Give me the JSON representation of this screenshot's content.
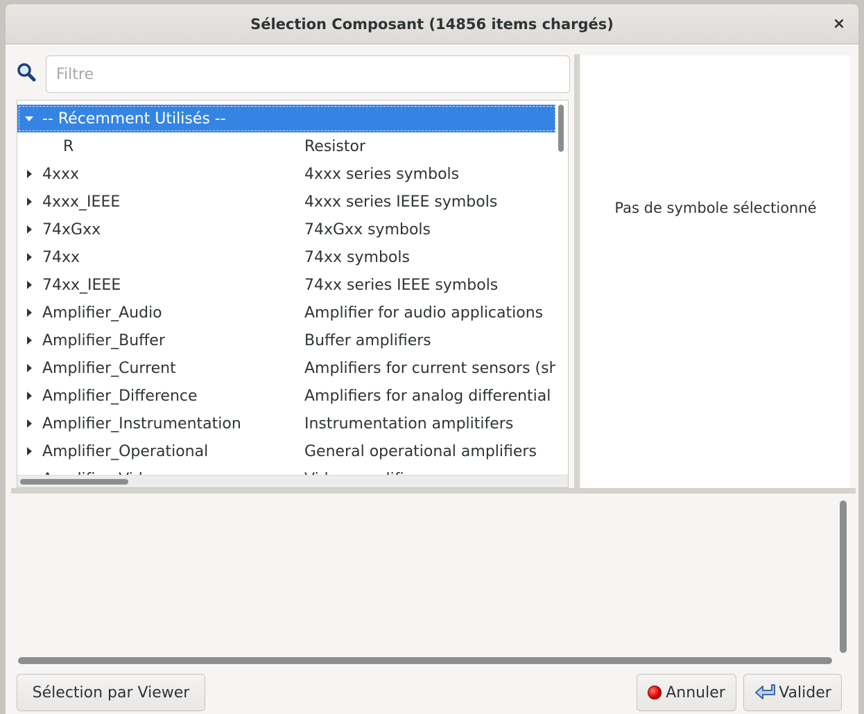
{
  "window": {
    "title": "Sélection Composant (14856 items chargés)",
    "close_label": "×"
  },
  "filter": {
    "placeholder": "Filtre",
    "value": ""
  },
  "tree": {
    "rows": [
      {
        "name": "-- Récemment Utilisés --",
        "desc": "",
        "state": "expanded",
        "selected": true,
        "child": false
      },
      {
        "name": "R",
        "desc": "Resistor",
        "state": "leaf",
        "selected": false,
        "child": true
      },
      {
        "name": "4xxx",
        "desc": "4xxx series symbols",
        "state": "collapsed",
        "selected": false,
        "child": false
      },
      {
        "name": "4xxx_IEEE",
        "desc": "4xxx series IEEE symbols",
        "state": "collapsed",
        "selected": false,
        "child": false
      },
      {
        "name": "74xGxx",
        "desc": "74xGxx symbols",
        "state": "collapsed",
        "selected": false,
        "child": false
      },
      {
        "name": "74xx",
        "desc": "74xx symbols",
        "state": "collapsed",
        "selected": false,
        "child": false
      },
      {
        "name": "74xx_IEEE",
        "desc": "74xx series IEEE symbols",
        "state": "collapsed",
        "selected": false,
        "child": false
      },
      {
        "name": "Amplifier_Audio",
        "desc": "Amplifier for audio applications",
        "state": "collapsed",
        "selected": false,
        "child": false
      },
      {
        "name": "Amplifier_Buffer",
        "desc": "Buffer amplifiers",
        "state": "collapsed",
        "selected": false,
        "child": false
      },
      {
        "name": "Amplifier_Current",
        "desc": "Amplifiers for current sensors (shu",
        "state": "collapsed",
        "selected": false,
        "child": false
      },
      {
        "name": "Amplifier_Difference",
        "desc": "Amplifiers for analog differential s",
        "state": "collapsed",
        "selected": false,
        "child": false
      },
      {
        "name": "Amplifier_Instrumentation",
        "desc": "Instrumentation amplitifers",
        "state": "collapsed",
        "selected": false,
        "child": false
      },
      {
        "name": "Amplifier_Operational",
        "desc": "General operational amplifiers",
        "state": "collapsed",
        "selected": false,
        "child": false
      },
      {
        "name": "Amplifier_Video",
        "desc": "Video amplifiers",
        "state": "collapsed",
        "selected": false,
        "child": false
      }
    ]
  },
  "preview": {
    "empty_text": "Pas de symbole sélectionné"
  },
  "buttons": {
    "viewer": "Sélection par Viewer",
    "cancel": "Annuler",
    "ok": "Valider"
  },
  "colors": {
    "selection": "#3584e4",
    "window_bg": "#f6f5f4",
    "cancel_icon": "#e00000"
  }
}
